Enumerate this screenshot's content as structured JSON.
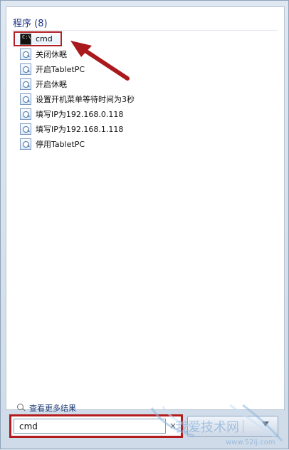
{
  "programs": {
    "heading": "程序 (8)",
    "items": [
      {
        "label": "cmd",
        "icon": "cmd-icon",
        "selected": true
      },
      {
        "label": "关闭休眠",
        "icon": "program-icon"
      },
      {
        "label": "开启TabletPC",
        "icon": "program-icon"
      },
      {
        "label": "开启休眠",
        "icon": "program-icon"
      },
      {
        "label": "设置开机菜单等待时间为3秒",
        "icon": "program-icon"
      },
      {
        "label": "填写IP为192.168.0.118",
        "icon": "program-icon"
      },
      {
        "label": "填写IP为192.168.1.118",
        "icon": "program-icon"
      },
      {
        "label": "停用TabletPC",
        "icon": "program-icon"
      }
    ]
  },
  "see_more": {
    "label": "查看更多结果",
    "icon": "search-icon"
  },
  "search": {
    "value": "cmd",
    "clear_icon": "close-icon"
  },
  "shutdown": {
    "icon": "chevron-right-icon"
  },
  "colors": {
    "annotation_red": "#b11f24",
    "heading_blue": "#1e3287",
    "panel_background": "#ffffff"
  },
  "watermark": {
    "text": "我爱技术网",
    "domain": "www.52ij.com"
  }
}
